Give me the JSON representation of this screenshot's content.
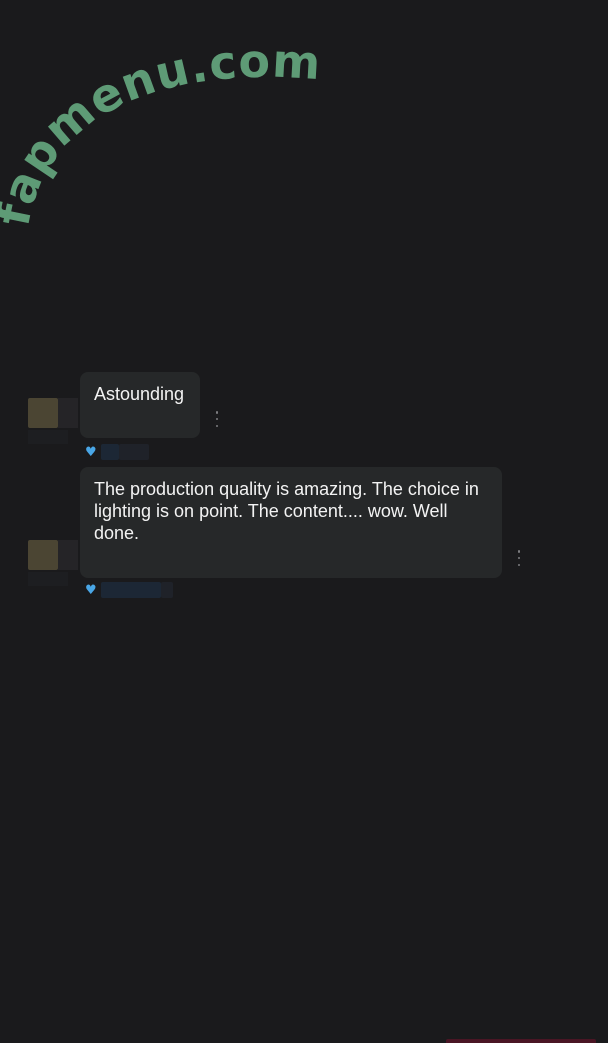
{
  "watermark": {
    "text": "fapmenu.com",
    "color": "#5e9b76"
  },
  "comments": [
    {
      "text": "Astounding",
      "reaction_icon": "blue-heart-icon",
      "reaction_color": "#49a6e6"
    },
    {
      "text": "The production quality is amazing. The choice in lighting is on point. The content.... wow. Well done.",
      "reaction_icon": "blue-heart-icon",
      "reaction_color": "#49a6e6"
    }
  ],
  "more_options_icon": "vertical-ellipsis-icon",
  "colors": {
    "background": "#1a1a1c",
    "bubble": "#262829",
    "text": "#f3f3f3",
    "heart": "#49a6e6"
  }
}
